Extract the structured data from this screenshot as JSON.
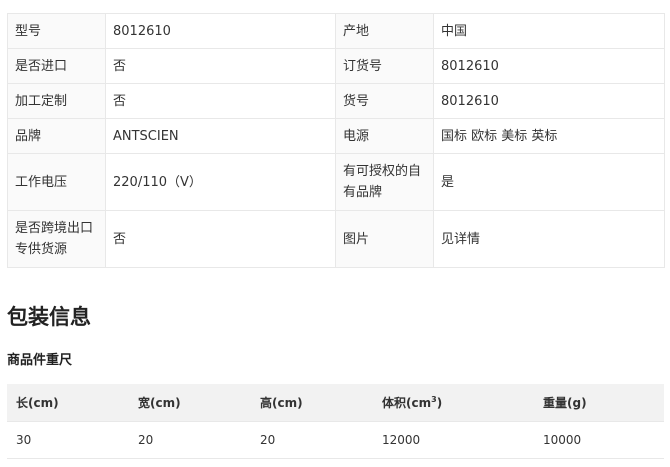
{
  "spec": {
    "rows": [
      [
        {
          "k": "型号",
          "v": "8012610"
        },
        {
          "k": "产地",
          "v": "中国"
        }
      ],
      [
        {
          "k": "是否进口",
          "v": "否"
        },
        {
          "k": "订货号",
          "v": "8012610"
        }
      ],
      [
        {
          "k": "加工定制",
          "v": "否"
        },
        {
          "k": "货号",
          "v": "8012610"
        }
      ],
      [
        {
          "k": "品牌",
          "v": "ANTSCIEN"
        },
        {
          "k": "电源",
          "v": "国标 欧标 美标 英标"
        }
      ],
      [
        {
          "k": "工作电压",
          "v": "220/110（V）"
        },
        {
          "k": "有可授权的自有品牌",
          "v": "是"
        }
      ],
      [
        {
          "k": "是否跨境出口专供货源",
          "v": "否"
        },
        {
          "k": "图片",
          "v": "见详情"
        }
      ]
    ]
  },
  "package": {
    "title": "包装信息",
    "subtitle": "商品件重尺",
    "headers": {
      "length": "长(cm)",
      "width": "宽(cm)",
      "height": "高(cm)",
      "volume": "体积(cm",
      "volume_sup": "3",
      "volume_close": ")",
      "weight": "重量(g)"
    },
    "row": {
      "length": "30",
      "width": "20",
      "height": "20",
      "volume": "12000",
      "weight": "10000"
    }
  }
}
